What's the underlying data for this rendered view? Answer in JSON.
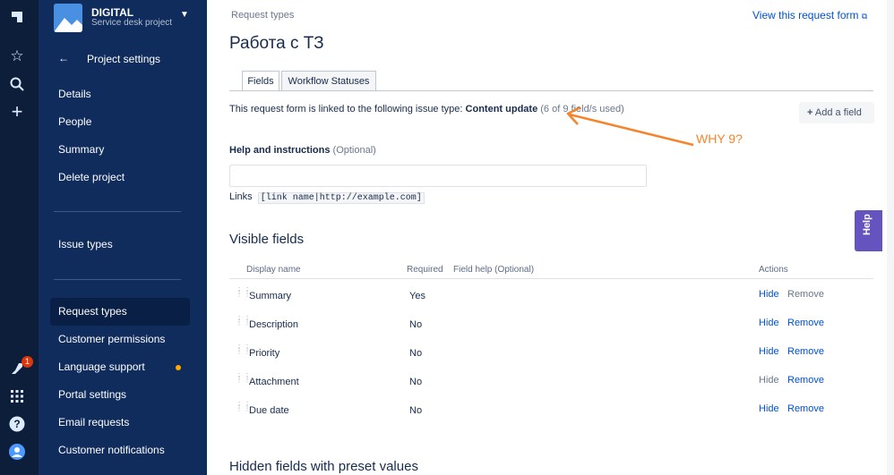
{
  "sidebar": {
    "project_name": "DIGITAL",
    "project_type": "Service desk project",
    "back_label": "Project settings",
    "items": [
      {
        "label": "Details"
      },
      {
        "label": "People"
      },
      {
        "label": "Summary"
      },
      {
        "label": "Delete project"
      },
      {
        "label": "Issue types"
      },
      {
        "label": "Request types"
      },
      {
        "label": "Customer permissions"
      },
      {
        "label": "Language support"
      },
      {
        "label": "Portal settings"
      },
      {
        "label": "Email requests"
      },
      {
        "label": "Customer notifications"
      }
    ],
    "notification_count": "1"
  },
  "header": {
    "breadcrumb": "Request types",
    "view_link": "View this request form",
    "title": "Работа с ТЗ"
  },
  "tabs": [
    {
      "label": "Fields"
    },
    {
      "label": "Workflow Statuses"
    }
  ],
  "linked": {
    "prefix": "This request form is linked to the following issue type:",
    "issue_type": "Content update",
    "usage": "(6 of 9 field/s used)"
  },
  "add_field_label": "Add a field",
  "annotation": "WHY 9?",
  "help": {
    "label": "Help and instructions",
    "optional": "(Optional)",
    "value": "",
    "links_label": "Links",
    "links_example": "[link name|http://example.com]"
  },
  "visible_fields": {
    "heading": "Visible fields",
    "columns": {
      "display_name": "Display name",
      "required": "Required",
      "field_help": "Field help",
      "field_help_optional": "(Optional)",
      "actions": "Actions"
    },
    "rows": [
      {
        "name": "Summary",
        "required": "Yes",
        "hide": "Hide",
        "remove": "Remove"
      },
      {
        "name": "Description",
        "required": "No",
        "hide": "Hide",
        "remove": "Remove"
      },
      {
        "name": "Priority",
        "required": "No",
        "hide": "Hide",
        "remove": "Remove"
      },
      {
        "name": "Attachment",
        "required": "No",
        "hide": "Hide",
        "remove": "Remove"
      },
      {
        "name": "Due date",
        "required": "No",
        "hide": "Hide",
        "remove": "Remove"
      }
    ]
  },
  "hidden_fields_heading": "Hidden fields with preset values",
  "help_tab_label": "Help",
  "colors": {
    "rail": "#0d1e3b",
    "sidebar": "#0f2c5c",
    "link": "#0052cc",
    "annotation": "#f5842c",
    "help_tab": "#6554c0"
  }
}
